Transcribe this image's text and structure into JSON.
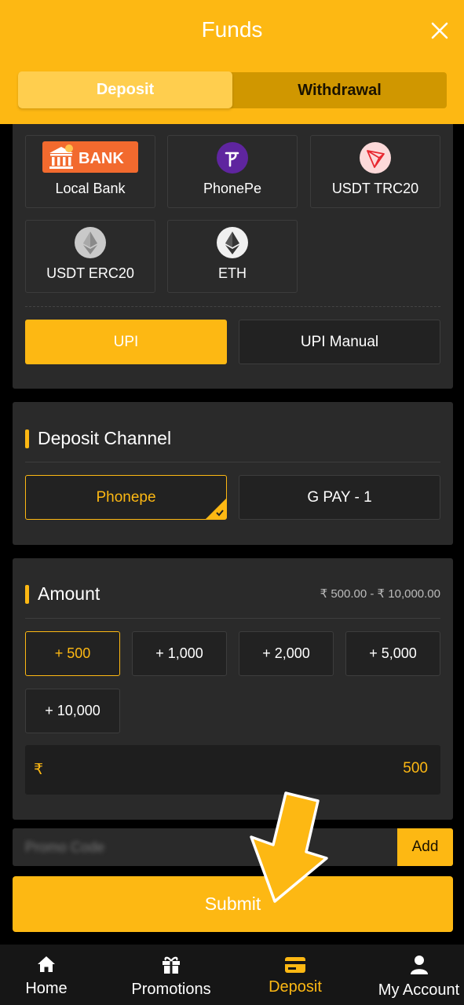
{
  "header": {
    "title": "Funds"
  },
  "tabs": {
    "deposit": "Deposit",
    "withdrawal": "Withdrawal"
  },
  "payment_methods": [
    {
      "label": "Local Bank",
      "icon": "bank-logo",
      "logo_text": "BANK"
    },
    {
      "label": "PhonePe",
      "icon": "phonepe-icon"
    },
    {
      "label": "USDT TRC20",
      "icon": "tron-icon"
    },
    {
      "label": "USDT ERC20",
      "icon": "ethereum-gray-icon"
    },
    {
      "label": "ETH",
      "icon": "ethereum-icon"
    }
  ],
  "sub_methods": {
    "upi": "UPI",
    "upi_manual": "UPI Manual"
  },
  "deposit_channel": {
    "title": "Deposit Channel",
    "options": [
      "Phonepe",
      "G PAY - 1"
    ]
  },
  "amount": {
    "title": "Amount",
    "range": "₹ 500.00 - ₹ 10,000.00",
    "quick_amounts": [
      "+ 500",
      "+ 1,000",
      "+ 2,000",
      "+ 5,000",
      "+ 10,000"
    ],
    "currency_symbol": "₹",
    "value": "500"
  },
  "promo": {
    "placeholder": "Promo Code",
    "add_label": "Add"
  },
  "submit_label": "Submit",
  "nav": [
    {
      "label": "Home",
      "icon": "home-icon"
    },
    {
      "label": "Promotions",
      "icon": "gift-icon"
    },
    {
      "label": "Deposit",
      "icon": "card-icon"
    },
    {
      "label": "My Account",
      "icon": "user-icon"
    }
  ],
  "colors": {
    "accent": "#FDB813",
    "panel": "#2a2a2a",
    "background": "#000000"
  }
}
